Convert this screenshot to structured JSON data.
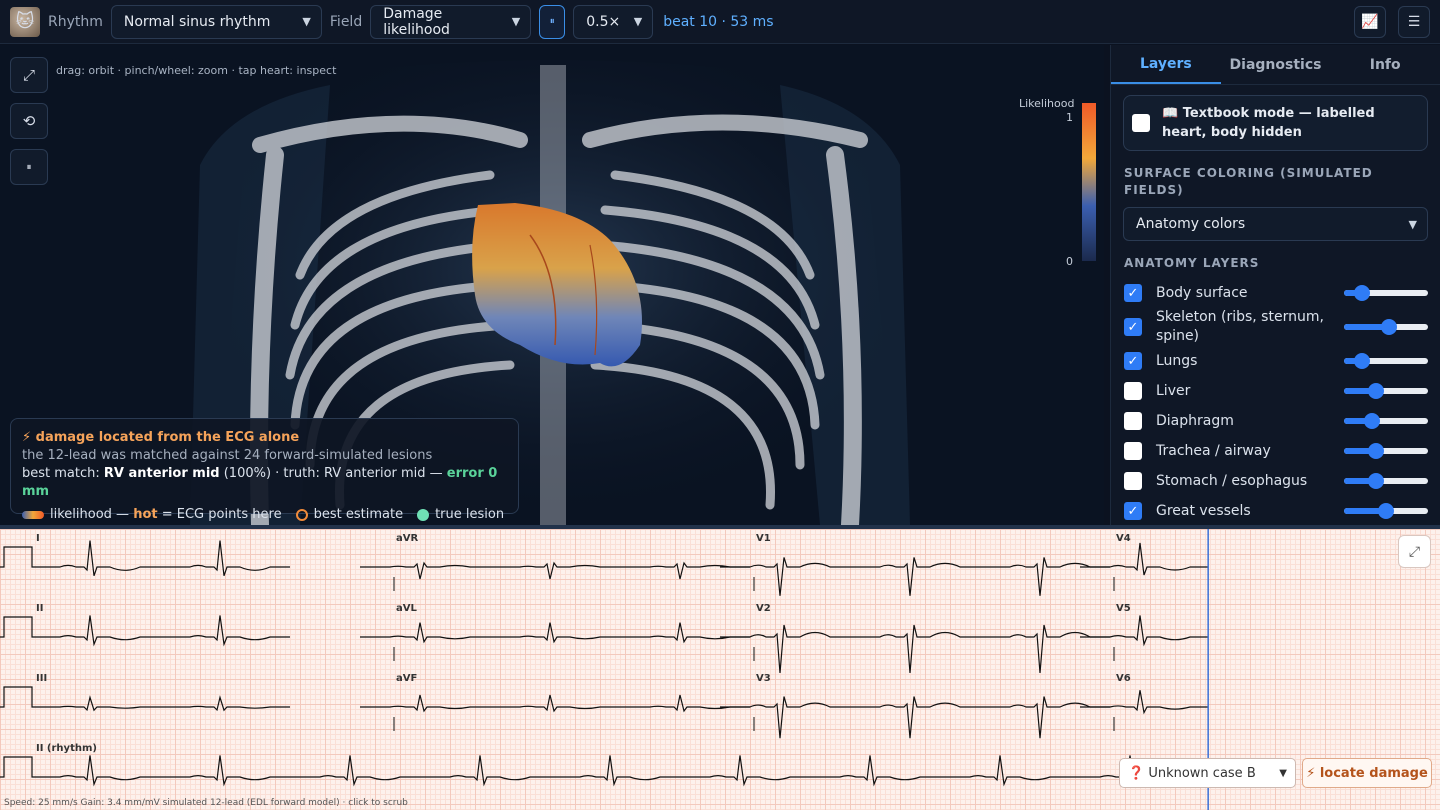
{
  "topbar": {
    "rhythm_label": "Rhythm",
    "rhythm_value": "Normal sinus rhythm",
    "field_label": "Field",
    "field_value": "Damage likelihood",
    "pause_glyph": "⏸",
    "speed_value": "0.5×",
    "beat_status": "beat 10 · 53 ms",
    "chart_icon": "📈",
    "menu_icon": "☰"
  },
  "viewport": {
    "hint": "drag: orbit · pinch/wheel: zoom · tap heart: inspect",
    "expand_icon": "⤢",
    "reset_icon": "⟲",
    "pause_icon": "⏸",
    "colorbar": {
      "label": "Likelihood",
      "max": "1",
      "min": "0"
    }
  },
  "result_card": {
    "title": "⚡ damage located from the ECG alone",
    "subtitle": "the 12-lead was matched against 24 forward-simulated lesions",
    "best_prefix": "best match: ",
    "best_value": "RV anterior mid",
    "best_score": " (100%) · truth: RV anterior mid — ",
    "error_text": "error 0 mm",
    "legend_likelihood": "likelihood — ",
    "legend_hot": "hot",
    "legend_hot_rest": " = ECG points here",
    "legend_best": "best estimate",
    "legend_true": "true lesion"
  },
  "panel": {
    "tabs": [
      {
        "label": "Layers",
        "active": true
      },
      {
        "label": "Diagnostics",
        "active": false
      },
      {
        "label": "Info",
        "active": false
      }
    ],
    "textbook": "📖 Textbook mode — labelled heart, body hidden",
    "surface_heading": "SURFACE COLORING (SIMULATED FIELDS)",
    "surface_value": "Anatomy colors",
    "anatomy_heading": "ANATOMY LAYERS",
    "layers": [
      {
        "name": "Body surface",
        "checked": true,
        "opacity": 0.15
      },
      {
        "name": "Skeleton (ribs, sternum, spine)",
        "checked": true,
        "opacity": 0.55
      },
      {
        "name": "Lungs",
        "checked": true,
        "opacity": 0.15
      },
      {
        "name": "Liver",
        "checked": false,
        "opacity": 0.35
      },
      {
        "name": "Diaphragm",
        "checked": false,
        "opacity": 0.3
      },
      {
        "name": "Trachea / airway",
        "checked": false,
        "opacity": 0.35
      },
      {
        "name": "Stomach / esophagus",
        "checked": false,
        "opacity": 0.35
      },
      {
        "name": "Great vessels",
        "checked": true,
        "opacity": 0.5
      }
    ]
  },
  "ecg": {
    "leads": [
      "I",
      "aVR",
      "V1",
      "V4",
      "II",
      "aVL",
      "V2",
      "V5",
      "III",
      "aVF",
      "V3",
      "V6",
      "II (rhythm)"
    ],
    "footer": "Speed: 25 mm/s   Gain: 3.4 mm/mV   simulated 12-lead (EDL forward model) · click to scrub",
    "expand_icon": "⤢",
    "case_value": "❓ Unknown case B",
    "locate_label": "⚡ locate damage",
    "scrub_fraction": 0.839
  },
  "colors": {
    "accent": "#3a8ee6",
    "hot": "#f5a35a",
    "true_lesion": "#6fe0b5",
    "trace": "#111111"
  }
}
